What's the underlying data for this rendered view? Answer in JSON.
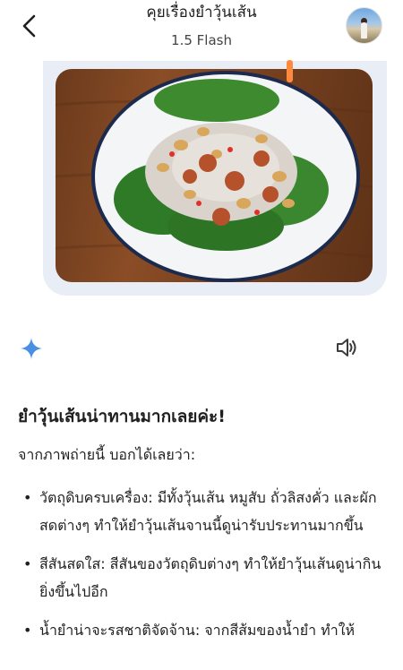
{
  "header": {
    "title": "คุยเรื่องยำวุ้นเส้น",
    "subtitle": "1.5 Flash"
  },
  "response": {
    "heading": "ยำวุ้นเส้นน่าทานมากเลยค่ะ!",
    "intro": "จากภาพถ่ายนี้ บอกได้เลยว่า:",
    "items": [
      "วัตถุดิบครบเครื่อง: มีทั้งวุ้นเส้น หมูสับ ถั่วลิสงคั่ว และผักสดต่างๆ ทำให้ยำวุ้นเส้นจานนี้ดูน่ารับประทานมากขึ้น",
      "สีสันสดใส: สีสันของวัตถุดิบต่างๆ ทำให้ยำวุ้นเส้นดูน่ากินยิ่งขึ้นไปอีก",
      "น้ำยำน่าจะรสชาติจัดจ้าน: จากสีส้มของน้ำยำ ทำให้"
    ]
  },
  "colors": {
    "bubble": "#e9eef6",
    "sparkle": "#4a90e2",
    "accent_orange": "#ff8a3d"
  },
  "icons": {
    "back": "chevron-left-icon",
    "assistant": "sparkle-icon",
    "read_aloud": "speaker-icon"
  }
}
